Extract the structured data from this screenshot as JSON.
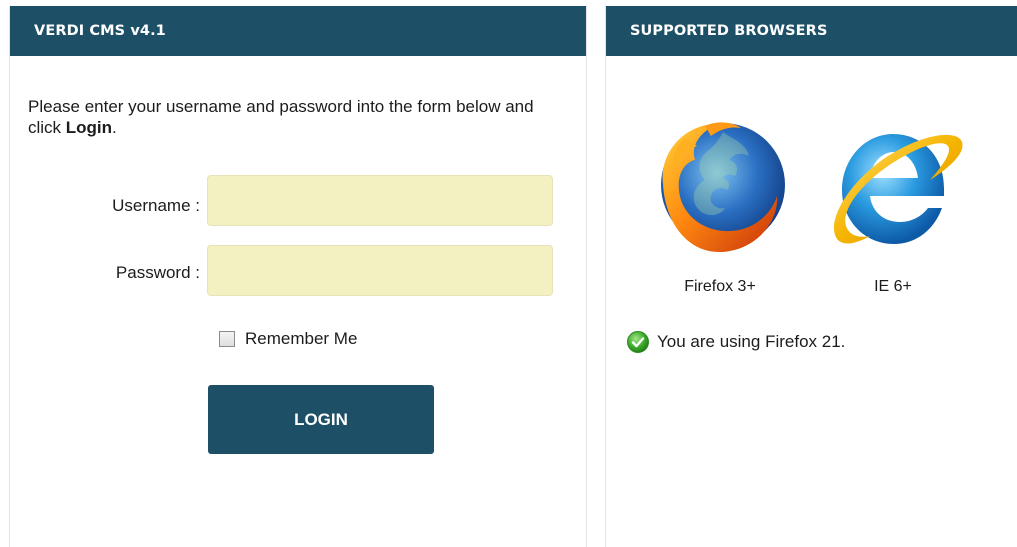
{
  "login_panel": {
    "title": "VERDI CMS v4.1",
    "intro_text": "Please enter your username and password into the form below and click ",
    "intro_bold": "Login",
    "intro_end": ".",
    "username_label": "Username :",
    "username_value": "",
    "password_label": "Password :",
    "password_value": "",
    "remember_label": "Remember Me",
    "remember_checked": false,
    "login_button": "LOGIN"
  },
  "browsers_panel": {
    "title": "SUPPORTED BROWSERS",
    "browsers": [
      {
        "name": "Firefox 3+",
        "icon": "firefox-icon"
      },
      {
        "name": "IE 6+",
        "icon": "internet-explorer-icon"
      }
    ],
    "detected_text": "You are using Firefox 21.",
    "detected_icon": "check-icon"
  },
  "colors": {
    "header_bg": "#1d5067",
    "input_bg": "#f3f0c2",
    "success_green": "#3fae2a"
  }
}
